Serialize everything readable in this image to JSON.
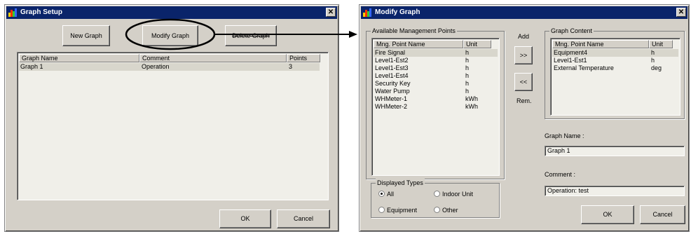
{
  "graph_setup": {
    "title": "Graph Setup",
    "close_glyph": "✕",
    "new_graph_label": "New Graph",
    "modify_graph_label": "Modify Graph",
    "delete_graph_label": "Delete Graph",
    "columns": [
      "Graph Name",
      "Comment",
      "Points"
    ],
    "rows": [
      {
        "name": "Graph 1",
        "comment": "Operation",
        "points": "3"
      }
    ],
    "ok_label": "OK",
    "cancel_label": "Cancel"
  },
  "modify_graph": {
    "title": "Modify Graph",
    "close_glyph": "✕",
    "available_title": "Available Management Points",
    "available_columns": [
      "Mng. Point Name",
      "Unit"
    ],
    "available_rows": [
      {
        "name": "Fire Signal",
        "unit": "h"
      },
      {
        "name": "Level1-Est2",
        "unit": "h"
      },
      {
        "name": "Level1-Est3",
        "unit": "h"
      },
      {
        "name": "Level1-Est4",
        "unit": "h"
      },
      {
        "name": "Security Key",
        "unit": "h"
      },
      {
        "name": "Water Pump",
        "unit": "h"
      },
      {
        "name": "WHMeter-1",
        "unit": "kWh"
      },
      {
        "name": "WHMeter-2",
        "unit": "kWh"
      }
    ],
    "add_label": "Add",
    "add_button": ">>",
    "remove_button": "<<",
    "remove_label": "Rem.",
    "content_title": "Graph Content",
    "content_columns": [
      "Mng. Point Name",
      "Unit"
    ],
    "content_rows": [
      {
        "name": "Equipment4",
        "unit": "h"
      },
      {
        "name": "Level1-Est1",
        "unit": "h"
      },
      {
        "name": "External Temperature",
        "unit": "deg"
      }
    ],
    "displayed_types_title": "Displayed Types",
    "radio_all": "All",
    "radio_indoor": "Indoor Unit",
    "radio_equipment": "Equipment",
    "radio_other": "Other",
    "selected_type": "All",
    "graph_name_label": "Graph Name :",
    "graph_name_value": "Graph 1",
    "comment_label": "Comment :",
    "comment_value": "Operation: test",
    "ok_label": "OK",
    "cancel_label": "Cancel"
  }
}
